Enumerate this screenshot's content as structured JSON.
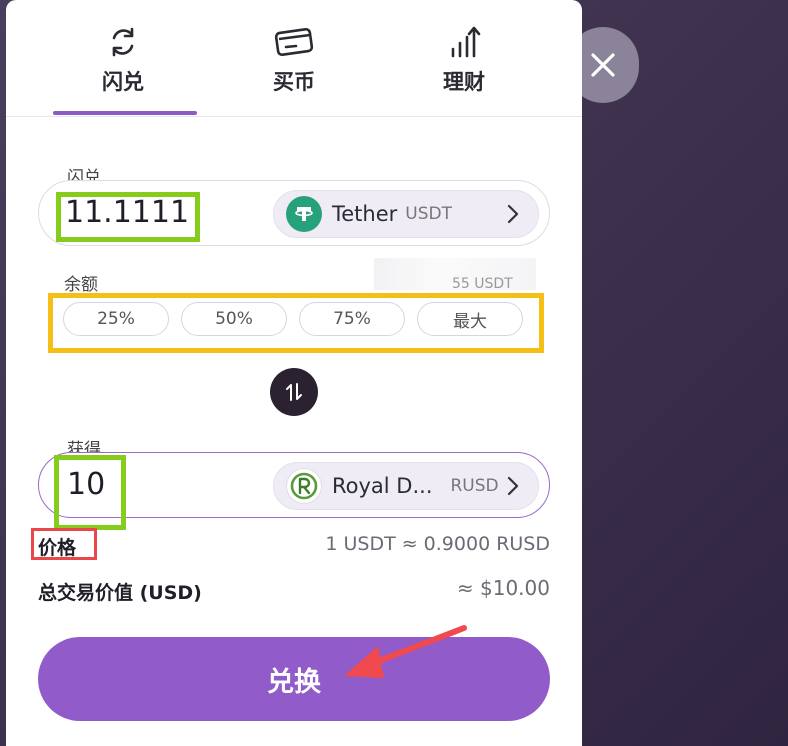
{
  "tabs": [
    {
      "label": "闪兑",
      "icon": "swap-cycle-icon",
      "active": true
    },
    {
      "label": "买币",
      "icon": "card-icon",
      "active": false
    },
    {
      "label": "理财",
      "icon": "growth-chart-icon",
      "active": false
    }
  ],
  "from": {
    "section_label": "闪兑",
    "amount": "11.1111",
    "token_name": "Tether",
    "token_symbol": "USDT"
  },
  "balance": {
    "label": "余额",
    "value_partial": "55 USDT",
    "percent_options": [
      "25%",
      "50%",
      "75%",
      "最大"
    ]
  },
  "to": {
    "section_label": "获得",
    "amount": "10",
    "token_name": "Royal D...",
    "token_symbol": "RUSD"
  },
  "price": {
    "label": "价格",
    "value": "1 USDT ≈ 0.9000 RUSD"
  },
  "total": {
    "label": "总交易价值 (USD)",
    "value": "≈ $10.00"
  },
  "submit_label": "兑换",
  "colors": {
    "accent": "#915bc9",
    "tether": "#26a17b",
    "royal": "#5a9a3a",
    "highlight_green": "#86cc1c",
    "highlight_yellow": "#f5bf16",
    "highlight_red": "#e8484a",
    "arrow": "#f04a4f"
  }
}
